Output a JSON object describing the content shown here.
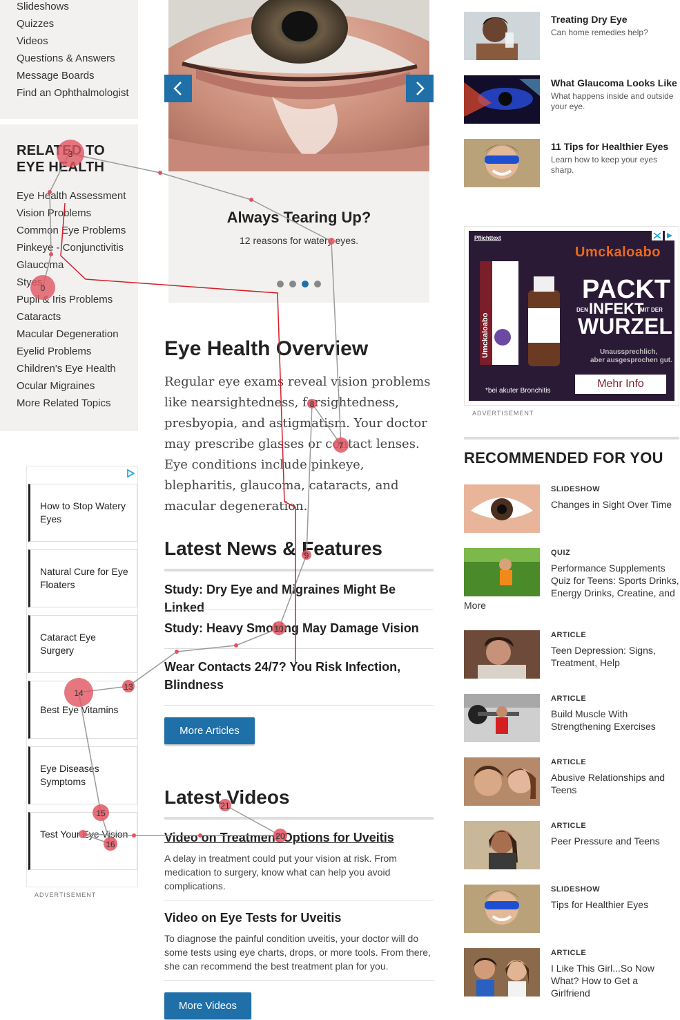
{
  "nav": {
    "items": [
      "Slideshows",
      "Quizzes",
      "Videos",
      "Questions & Answers",
      "Message Boards",
      "Find an Ophthalmologist"
    ]
  },
  "related": {
    "title_line1": "RELATED TO",
    "title_line2": "EYE HEALTH",
    "items": [
      "Eye Health Assessment",
      "Vision Problems",
      "Common Eye Problems",
      "Pinkeye - Conjunctivitis",
      "Glaucoma",
      "Styes",
      "Pupil & Iris Problems",
      "Cataracts",
      "Macular Degeneration",
      "Eyelid Problems",
      "Children's Eye Health",
      "Ocular Migraines",
      "More Related Topics"
    ]
  },
  "left_ad": {
    "items": [
      "How to Stop Watery Eyes",
      "Natural Cure for Eye Floaters",
      "Cataract Eye Surgery",
      "Best Eye Vitamins",
      "Eye Diseases Symptoms",
      "Test Your Eye Vision"
    ],
    "label": "ADVERTISEMENT"
  },
  "carousel": {
    "title": "Always Tearing Up?",
    "subtitle": "12 reasons for watery eyes.",
    "active_dot": 2
  },
  "overview": {
    "title": "Eye Health Overview",
    "text": "Regular eye exams reveal vision problems like nearsightedness, farsightedness, presbyopia, and astigmatism. Your doctor may prescribe glasses or contact lenses. Eye conditions include pinkeye, blepharitis, glaucoma, cataracts, and macular degeneration."
  },
  "news": {
    "title": "Latest News & Features",
    "items": [
      "Study: Dry Eye and Migraines Might Be Linked",
      "Study: Heavy Smoking May Damage Vision",
      "Wear Contacts 24/7? You Risk Infection, Blindness"
    ],
    "button": "More Articles"
  },
  "videos": {
    "title": "Latest Videos",
    "items": [
      {
        "title": "Video on Treatment Options for Uveitis",
        "desc": "A delay in treatment could put your vision at risk. From medication to surgery, know what can help you avoid complications."
      },
      {
        "title": "Video on Eye Tests for Uveitis",
        "desc": "To diagnose the painful condition uveitis, your doctor will do some tests using eye charts, drops, or more tools. From there, she can recommend the best treatment plan for you."
      }
    ],
    "button": "More Videos"
  },
  "right_top": [
    {
      "title": "Treating Dry Eye",
      "sub": "Can home remedies help?"
    },
    {
      "title": "What Glaucoma Looks Like",
      "sub": "What happens inside and outside your eye."
    },
    {
      "title": "11 Tips for Healthier Eyes",
      "sub": "Learn how to keep your eyes sharp."
    }
  ],
  "right_ad": {
    "pflicht": "Pflichttext",
    "brand": "Umckaloabo",
    "headline1": "PACKT",
    "headline_small1": "DEN",
    "headline2": "INFEKT",
    "headline_small2": "MIT DER",
    "headline3": "WURZEL",
    "tagline1": "Unaussprechlich,",
    "tagline2": "aber ausgesprochen gut.",
    "footnote": "*bei akuter Bronchitis",
    "cta": "Mehr Info",
    "box_brand": "Umckaloabo",
    "label": "ADVERTISEMENT"
  },
  "recommended": {
    "title": "RECOMMENDED FOR YOU",
    "items": [
      {
        "kind": "SLIDESHOW",
        "text": "Changes in Sight Over Time"
      },
      {
        "kind": "QUIZ",
        "text": "Performance Supplements Quiz for Teens: Sports Drinks, Energy Drinks, Creatine, and",
        "extra": "More"
      },
      {
        "kind": "ARTICLE",
        "text": "Teen Depression: Signs, Treatment, Help"
      },
      {
        "kind": "ARTICLE",
        "text": "Build Muscle With Strengthening Exercises"
      },
      {
        "kind": "ARTICLE",
        "text": "Abusive Relationships and Teens"
      },
      {
        "kind": "ARTICLE",
        "text": "Peer Pressure and Teens"
      },
      {
        "kind": "SLIDESHOW",
        "text": "Tips for Healthier Eyes"
      },
      {
        "kind": "ARTICLE",
        "text": "I Like This Girl...So Now What? How to Get a Girlfriend"
      }
    ]
  },
  "gaze": {
    "labels": [
      "0",
      "3",
      "7",
      "8",
      "9",
      "10",
      "13",
      "14",
      "15",
      "16",
      "20",
      "21"
    ],
    "color": "#e05560"
  }
}
